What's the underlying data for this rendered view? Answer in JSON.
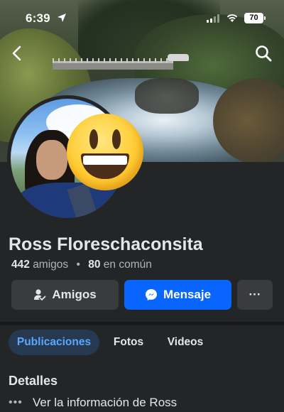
{
  "status_bar": {
    "time": "6:39",
    "battery": "70"
  },
  "profile": {
    "name": "Ross Floreschaconsita",
    "friends_count": "442",
    "friends_label": "amigos",
    "mutual_count": "80",
    "mutual_label": "en común"
  },
  "actions": {
    "friends_label": "Amigos",
    "message_label": "Mensaje",
    "more_label": "···"
  },
  "tabs": [
    {
      "label": "Publicaciones",
      "active": true
    },
    {
      "label": "Fotos"
    },
    {
      "label": "Videos"
    }
  ],
  "details": {
    "title": "Detalles",
    "see_info_label": "Ver la información de Ross"
  },
  "colors": {
    "accent": "#0866ff",
    "background": "#242526",
    "tab_active_bg": "#263951",
    "tab_active_text": "#5aa7ff"
  },
  "icons": [
    "location-arrow-icon",
    "cellular-signal-icon",
    "wifi-icon",
    "battery-icon",
    "back-chevron-icon",
    "search-icon",
    "friend-check-icon",
    "messenger-icon",
    "more-dots-icon"
  ]
}
